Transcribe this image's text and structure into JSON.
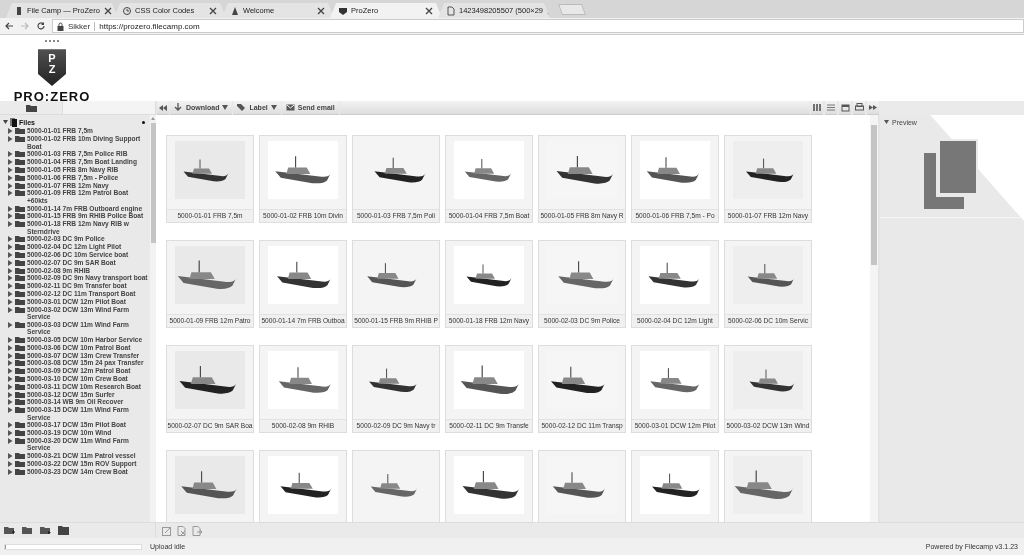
{
  "browser": {
    "tabs": [
      {
        "title": "File Camp — ProZero",
        "selected": false
      },
      {
        "title": "CSS Color Codes",
        "selected": false
      },
      {
        "title": "Welcome",
        "selected": false
      },
      {
        "title": "ProZero",
        "selected": true
      },
      {
        "title": "1423498205507 (500×29",
        "selected": false
      }
    ],
    "address": {
      "security_label": "Sikker",
      "url": "https://prozero.filecamp.com"
    }
  },
  "logo": {
    "monogram": "PZ",
    "wordmark": "PRO:ZERO"
  },
  "sidebar_tabs": [
    {
      "selected": true
    },
    {
      "selected": false
    }
  ],
  "toolbar": {
    "buttons": [
      {
        "label": "Download",
        "kind": "dropdown"
      },
      {
        "label": "Label",
        "kind": "dropdown"
      },
      {
        "label": "Send email",
        "kind": "plain"
      }
    ]
  },
  "tree": {
    "label": "Files",
    "expanded": true,
    "children": [
      {
        "label": "5000-01-01 FRB 7,5m",
        "expanded": false
      },
      {
        "label": "5000-01-02 FRB 10m Diving Support Boat",
        "expanded": false
      },
      {
        "label": "5000-01-03 FRB 7,5m Police RIB",
        "expanded": false
      },
      {
        "label": "5000-01-04 FRB 7,5m Boat Landing",
        "expanded": false
      },
      {
        "label": "5000-01-05 FRB 8m Navy RIB",
        "expanded": false
      },
      {
        "label": "5000-01-06 FRB 7,5m - Police",
        "expanded": false
      },
      {
        "label": "5000-01-07 FRB 12m Navy",
        "expanded": false
      },
      {
        "label": "5000-01-09 FRB 12m Patrol Boat +60kts",
        "expanded": false
      },
      {
        "label": "5000-01-14 7m FRB Outboard engine",
        "expanded": false
      },
      {
        "label": "5000-01-15 FRB 9m RHIB Police Boat",
        "expanded": false
      },
      {
        "label": "5000-01-18 FRB 12m Navy RIB w Sterndrive",
        "expanded": false
      },
      {
        "label": "5000-02-03 DC 9m Police",
        "expanded": false
      },
      {
        "label": "5000-02-04 DC 12m Light Pilot",
        "expanded": false
      },
      {
        "label": "5000-02-06 DC 10m Service boat",
        "expanded": false
      },
      {
        "label": "5000-02-07 DC 9m SAR Boat",
        "expanded": false
      },
      {
        "label": "5000-02-08 9m RHIB",
        "expanded": false
      },
      {
        "label": "5000-02-09 DC 9m Navy transport boat",
        "expanded": false
      },
      {
        "label": "5000-02-11 DC 9m Transfer boat",
        "expanded": false
      },
      {
        "label": "5000-02-12 DC 11m Transport Boat",
        "expanded": false
      },
      {
        "label": "5000-03-01 DCW 12m Pilot Boat",
        "expanded": false
      },
      {
        "label": "5000-03-02 DCW 13m Wind Farm Service",
        "expanded": false
      },
      {
        "label": "5000-03-03 DCW 11m Wind Farm Service",
        "expanded": false
      },
      {
        "label": "5000-03-05 DCW 10m Harbor Service",
        "expanded": false
      },
      {
        "label": "5000-03-06 DCW 10m Patrol Boat",
        "expanded": false
      },
      {
        "label": "5000-03-07 DCW 13m Crew Transfer",
        "expanded": false
      },
      {
        "label": "5000-03-08 DCW 15m 24 pax Transfer",
        "expanded": false
      },
      {
        "label": "5000-03-09 DCW 12m Patrol Boat",
        "expanded": false
      },
      {
        "label": "5000-03-10 DCW 10m Crew Boat",
        "expanded": false
      },
      {
        "label": "5000-03-11 DCW 10m Research Boat",
        "expanded": false
      },
      {
        "label": "5000-03-12 DCW 15m Surfer",
        "expanded": false
      },
      {
        "label": "5000-03-14 WB 9m Oil Recover",
        "expanded": false
      },
      {
        "label": "5000-03-15 DCW 11m Wind Farm Service",
        "expanded": false
      },
      {
        "label": "5000-03-17 DCW 15m Pilot Boat",
        "expanded": false
      },
      {
        "label": "5000-03-19 DCW 10m Wind",
        "expanded": false
      },
      {
        "label": "5000-03-20 DCW 11m Wind Farm Service",
        "expanded": false
      },
      {
        "label": "5000-03-21 DCW 11m Patrol vessel",
        "expanded": false
      },
      {
        "label": "5000-03-22 DCW 15m ROV Support",
        "expanded": false
      },
      {
        "label": "5000-03-23 DCW 14m Crew Boat",
        "expanded": false
      }
    ]
  },
  "thumbnails": [
    {
      "kind": "captioned",
      "caption": "5000-01-01 FRB 7,5m"
    },
    {
      "kind": "captioned",
      "caption": "5000-01-02 FRB 10m Divin"
    },
    {
      "kind": "captioned",
      "caption": "5000-01-03 FRB 7,5m Poli"
    },
    {
      "kind": "captioned",
      "caption": "5000-01-04 FRB 7,5m Boat"
    },
    {
      "kind": "captioned",
      "caption": "5000-01-05 FRB 8m Navy R"
    },
    {
      "kind": "captioned",
      "caption": "5000-01-06 FRB 7,5m - Po"
    },
    {
      "kind": "captioned",
      "caption": "5000-01-07 FRB 12m Navy"
    },
    {
      "kind": "captioned",
      "caption": "5000-01-09 FRB 12m Patro"
    },
    {
      "kind": "captioned",
      "caption": "5000-01-14 7m FRB Outboa"
    },
    {
      "kind": "captioned",
      "caption": "5000-01-15 FRB 9m RHIB P"
    },
    {
      "kind": "captioned",
      "caption": "5000-01-18 FRB 12m Navy"
    },
    {
      "kind": "captioned",
      "caption": "5000-02-03 DC 9m Police"
    },
    {
      "kind": "captioned",
      "caption": "5000-02-04 DC 12m Light"
    },
    {
      "kind": "captioned",
      "caption": "5000-02-06 DC 10m Servic"
    },
    {
      "kind": "captioned",
      "caption": "5000-02-07 DC 9m SAR Boa"
    },
    {
      "kind": "captioned",
      "caption": "5000-02-08 9m RHIB"
    },
    {
      "kind": "captioned",
      "caption": "5000-02-09 DC 9m Navy tr"
    },
    {
      "kind": "captioned",
      "caption": "5000-02-11 DC 9m Transfe"
    },
    {
      "kind": "captioned",
      "caption": "5000-02-12 DC 11m Transp"
    },
    {
      "kind": "captioned",
      "caption": "5000-03-01 DCW 12m Pilot"
    },
    {
      "kind": "captioned",
      "caption": "5000-03-02 DCW 13m Wind"
    },
    {
      "kind": "image_only"
    },
    {
      "kind": "image_only"
    },
    {
      "kind": "image_only"
    },
    {
      "kind": "image_only"
    },
    {
      "kind": "image_only"
    },
    {
      "kind": "image_only"
    },
    {
      "kind": "image_only"
    }
  ],
  "preview": {
    "title": "Preview",
    "expanded": true
  },
  "status_bar": {
    "upload_progress": {
      "level": 0.01
    },
    "upload_status": "Upload idle",
    "credit": "Powered by Filecamp v3.1.23"
  }
}
